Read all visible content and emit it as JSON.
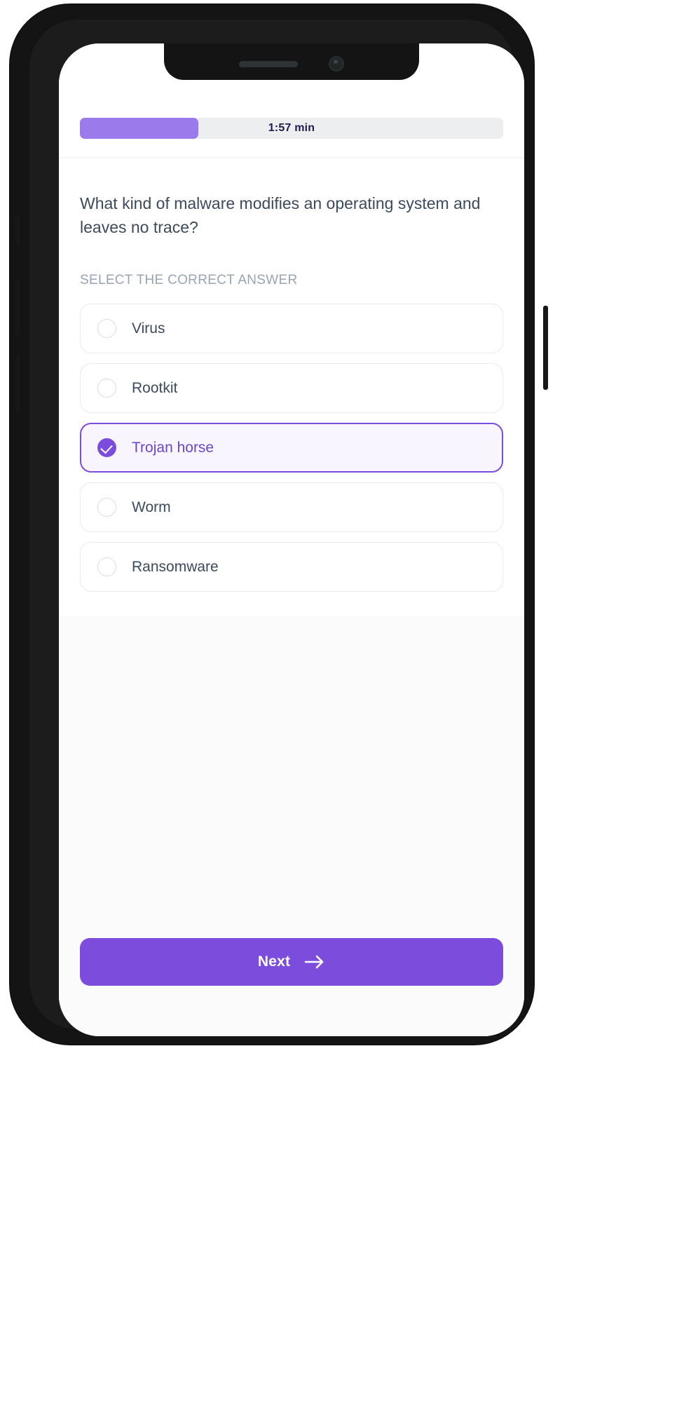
{
  "device": {
    "notch": {
      "speaker": "speaker-grille",
      "camera": "front-camera"
    },
    "buttons": {
      "silent": "silent-switch",
      "volume_up": "volume-up-button",
      "volume_down": "volume-down-button",
      "power": "power-button"
    }
  },
  "colors": {
    "accent": "#7c4ddc",
    "progress_fill": "#9b7aeb",
    "progress_track": "#eceef0",
    "selected_bg": "#f9f5fe",
    "selected_text": "#6b46c9",
    "body_text": "#3c4a5c",
    "muted_text": "#9aa3b4",
    "timer_text": "#221a4d",
    "card_border": "#e8eaee",
    "screen_bg": "#fbfbfc"
  },
  "timer": {
    "label": "1:57 min",
    "progress_percent": 28
  },
  "question": {
    "text": "What kind of malware modifies an operating system and leaves no trace?",
    "answers_heading": "SELECT THE CORRECT ANSWER",
    "selected_index": 2,
    "options": [
      {
        "label": "Virus",
        "selected": false
      },
      {
        "label": "Rootkit",
        "selected": false
      },
      {
        "label": "Trojan horse",
        "selected": true
      },
      {
        "label": "Worm",
        "selected": false
      },
      {
        "label": "Ransomware",
        "selected": false
      }
    ]
  },
  "footer": {
    "next_label": "Next",
    "next_icon": "arrow-right-icon"
  }
}
